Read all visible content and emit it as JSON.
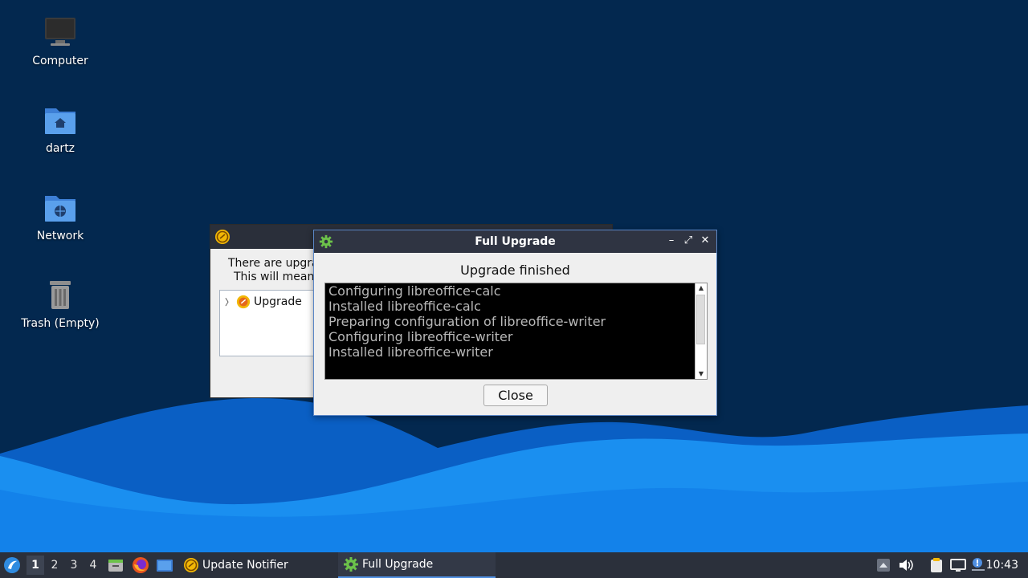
{
  "desktop": {
    "icons": [
      {
        "label": "Computer",
        "icon": "monitor-icon"
      },
      {
        "label": "dartz",
        "icon": "home-folder-icon"
      },
      {
        "label": "Network",
        "icon": "network-folder-icon"
      },
      {
        "label": "Trash (Empty)",
        "icon": "trash-icon"
      }
    ]
  },
  "update_window": {
    "line1": "There are upgra",
    "line2": "This will mean",
    "tree_item": "Upgrade"
  },
  "full_upgrade_window": {
    "title": "Full Upgrade",
    "status": "Upgrade finished",
    "log": [
      "Configuring libreoffice-calc",
      "Installed libreoffice-calc",
      "Preparing configuration of libreoffice-writer",
      "Configuring libreoffice-writer",
      "Installed libreoffice-writer"
    ],
    "close_label": "Close",
    "wm_buttons": {
      "minimize": "–",
      "maximize": "⤢",
      "close": "✕"
    }
  },
  "taskbar": {
    "workspaces": [
      "1",
      "2",
      "3",
      "4"
    ],
    "active_workspace": "1",
    "tasks": [
      {
        "label": "Update Notifier",
        "icon": "update-notifier-icon",
        "active": false
      },
      {
        "label": "Full Upgrade",
        "icon": "gear-icon",
        "active": true
      }
    ],
    "clock": "10:43"
  },
  "colors": {
    "desktop_bg": "#03284f",
    "wave_light": "#1a8ff0",
    "wave_dark": "#0565c8",
    "taskbar_bg": "#2b303b",
    "accent": "#4f8ee0"
  }
}
